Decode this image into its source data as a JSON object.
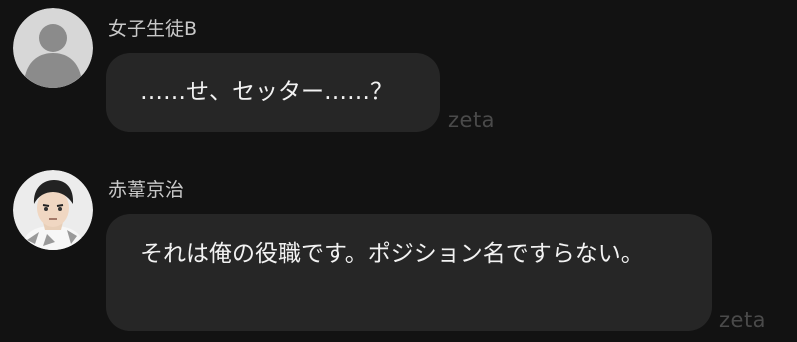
{
  "messages": [
    {
      "sender": "女子生徒B",
      "text": "……せ、セッター……？",
      "avatar_icon": "default-user-icon",
      "watermark": "zeta"
    },
    {
      "sender": "赤葦京治",
      "text": "それは俺の役職です。ポジション名ですらない。",
      "avatar_icon": "character-portrait",
      "watermark": "zeta"
    }
  ],
  "colors": {
    "background": "#121212",
    "bubble": "#262626",
    "sender_text": "#c9c9c9",
    "message_text": "#f2f2f2",
    "watermark": "#4a4a4a"
  }
}
